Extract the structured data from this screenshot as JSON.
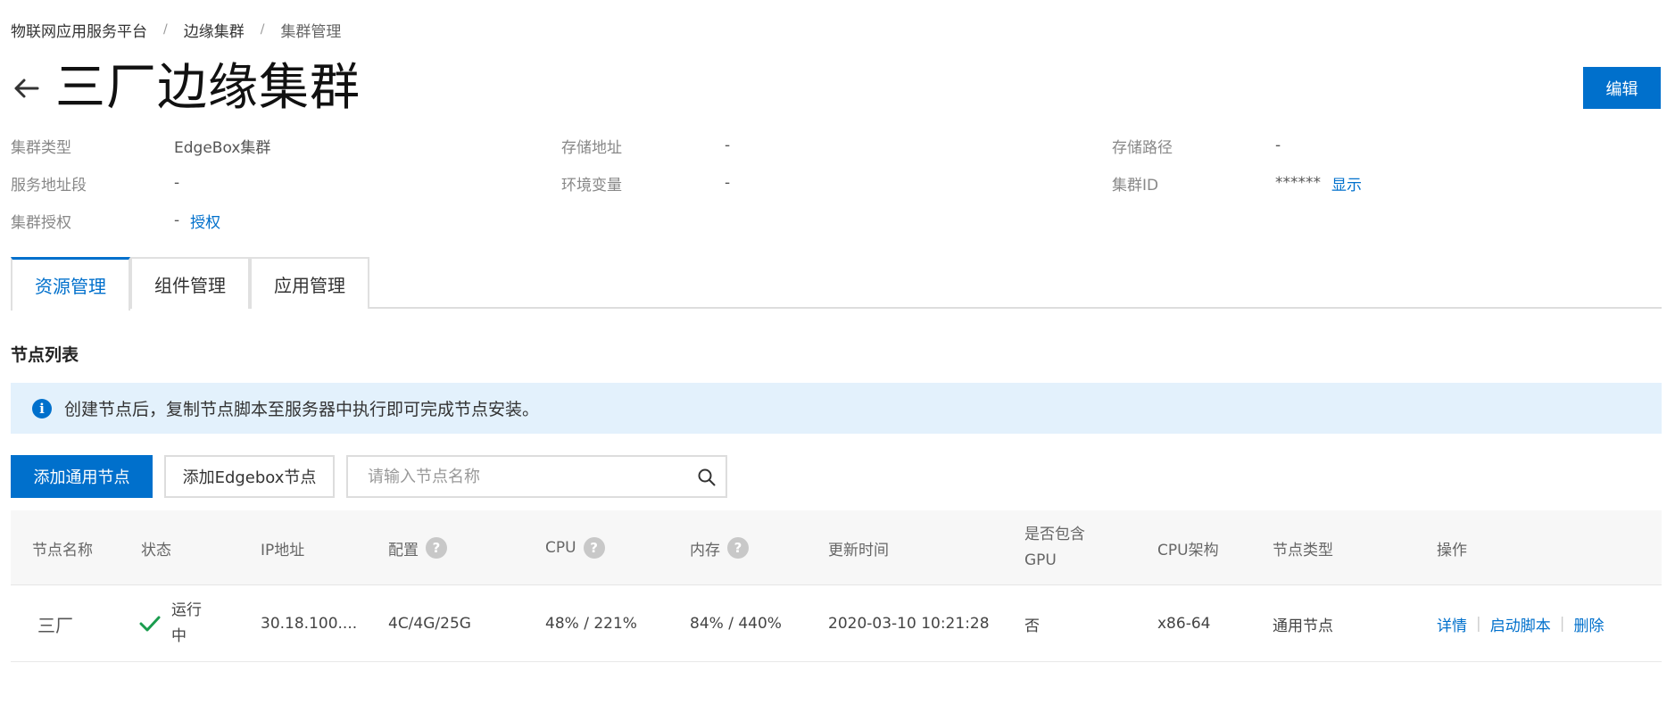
{
  "breadcrumb": {
    "items": [
      "物联网应用服务平台",
      "边缘集群",
      "集群管理"
    ],
    "separator": "/"
  },
  "header": {
    "title": "三厂边缘集群",
    "edit_label": "编辑"
  },
  "info": {
    "cluster_type_label": "集群类型",
    "cluster_type_value": "EdgeBox集群",
    "storage_address_label": "存储地址",
    "storage_address_value": "-",
    "storage_path_label": "存储路径",
    "storage_path_value": "-",
    "service_range_label": "服务地址段",
    "service_range_value": "-",
    "env_label": "环境变量",
    "env_value": "-",
    "cluster_id_label": "集群ID",
    "cluster_id_value": "******",
    "cluster_id_show": "显示",
    "auth_label": "集群授权",
    "auth_value": "-",
    "auth_link": "授权"
  },
  "tabs": [
    "资源管理",
    "组件管理",
    "应用管理"
  ],
  "section_title": "节点列表",
  "notice": {
    "text": "创建节点后，复制节点脚本至服务器中执行即可完成节点安装。"
  },
  "toolbar": {
    "add_general": "添加通用节点",
    "add_edgebox": "添加Edgebox节点",
    "search_placeholder": "请输入节点名称"
  },
  "table": {
    "headers": {
      "name": "节点名称",
      "status": "状态",
      "ip": "IP地址",
      "config": "配置",
      "cpu": "CPU",
      "memory": "内存",
      "updated": "更新时间",
      "gpu_line1": "是否包含",
      "gpu_line2": "GPU",
      "arch": "CPU架构",
      "node_type": "节点类型",
      "ops": "操作"
    },
    "rows": [
      {
        "name": "三厂",
        "status_line1": "运行",
        "status_line2": "中",
        "ip": "30.18.100....",
        "config": "4C/4G/25G",
        "cpu": "48% / 221%",
        "memory": "84% / 440%",
        "updated": "2020-03-10 10:21:28",
        "gpu": "否",
        "arch": "x86-64",
        "node_type": "通用节点",
        "op_detail": "详情",
        "op_script": "启动脚本",
        "op_delete": "删除"
      }
    ]
  },
  "colors": {
    "primary": "#0070cc",
    "notice_bg": "#e3f1fc",
    "success": "#1a9c4e"
  }
}
